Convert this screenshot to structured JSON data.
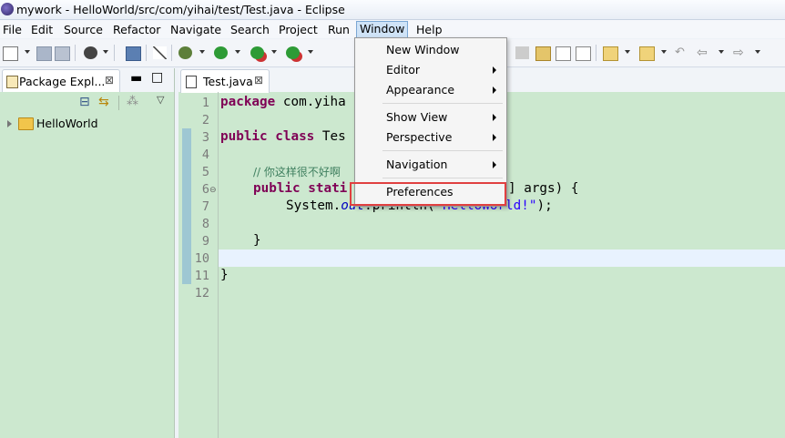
{
  "window": {
    "title": "mywork - HelloWorld/src/com/yihai/test/Test.java - Eclipse"
  },
  "menubar": {
    "items": [
      "File",
      "Edit",
      "Source",
      "Refactor",
      "Navigate",
      "Search",
      "Project",
      "Run",
      "Window",
      "Help"
    ],
    "active": "Window"
  },
  "package_explorer": {
    "tab_label": "Package Expl...",
    "tree": [
      {
        "label": "HelloWorld",
        "expanded": false
      }
    ]
  },
  "editor": {
    "tab_label": "Test.java",
    "line_numbers": [
      "1",
      "2",
      "3",
      "4",
      "5",
      "6",
      "7",
      "8",
      "9",
      "10",
      "11",
      "12"
    ],
    "code": {
      "l1_kw": "package",
      "l1_rest": " com.yiha",
      "l3_kw": "public class",
      "l3_rest": " Tes",
      "l5_comment": "// 你这样很不好啊",
      "l6_kw": "public stati",
      "l6_rest": "] args) {",
      "l7_a": "System.",
      "l7_field": "out",
      "l7_b": ".println(",
      "l7_str": "\"HelloWorld!\"",
      "l7_c": ");",
      "l9": "}",
      "l11": "}"
    }
  },
  "window_menu": {
    "items": [
      {
        "label": "New Window",
        "submenu": false
      },
      {
        "label": "Editor",
        "submenu": true
      },
      {
        "label": "Appearance",
        "submenu": true
      },
      {
        "label": "Show View",
        "submenu": true
      },
      {
        "label": "Perspective",
        "submenu": true
      },
      {
        "label": "Navigation",
        "submenu": true
      },
      {
        "label": "Preferences",
        "submenu": false
      }
    ],
    "highlighted": "Preferences"
  },
  "colors": {
    "editor_background": "#cce8cf",
    "keyword": "#7f0055",
    "comment": "#3f7f5f",
    "string": "#2a00ff",
    "highlight_border": "#e04040"
  }
}
